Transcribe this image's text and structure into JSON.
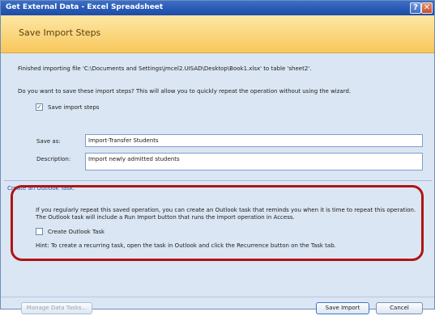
{
  "window": {
    "title": "Get External Data - Excel Spreadsheet"
  },
  "titlebar": {
    "help_glyph": "?",
    "close_glyph": "✕"
  },
  "header": {
    "title": "Save Import Steps"
  },
  "main": {
    "finished_text": "Finished importing file 'C:\\Documents and Settings\\jmcel2.UISAD\\Desktop\\Book1.xlsx' to table 'sheet2'.",
    "question_text": "Do you want to save these import steps? This will allow you to quickly repeat the operation without using the wizard.",
    "save_steps_checkbox": {
      "label": "Save import steps",
      "checked": true,
      "glyph": "✓"
    },
    "save_as": {
      "label": "Save as:",
      "value": "Import-Transfer Students"
    },
    "description": {
      "label": "Description:",
      "value": "Import newly admitted students"
    }
  },
  "outlook": {
    "heading": "Create an Outlook Task.",
    "line1": "If you regularly repeat this saved operation, you can create an Outlook task that reminds you when it is time to repeat this operation.",
    "line2": "The Outlook task will include a Run Import button that runs the import operation in Access.",
    "create_task_checkbox": {
      "label": "Create Outlook Task",
      "checked": false
    },
    "hint": "Hint: To create a recurring task, open the task in Outlook and click the Recurrence button on the Task tab."
  },
  "footer": {
    "manage_label": "Manage Data Tasks...",
    "save_import_label": "Save Import",
    "cancel_label": "Cancel"
  },
  "colors": {
    "title_bar": "#2658b4",
    "header_band": "#f8c75c",
    "highlight_oval": "#b01414",
    "body_bg": "#dbe6f4"
  }
}
